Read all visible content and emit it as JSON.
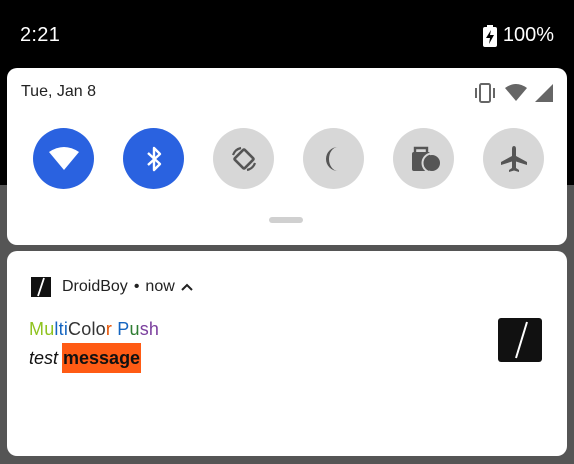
{
  "status_bar": {
    "time": "2:21",
    "battery_percent": "100%",
    "battery_icon": "battery-charging-icon"
  },
  "quick_settings": {
    "date": "Tue, Jan 8",
    "status_icons": [
      "vibrate-icon",
      "wifi-icon",
      "cell-signal-icon"
    ],
    "tiles": [
      {
        "name": "wifi",
        "icon": "wifi-icon",
        "active": true
      },
      {
        "name": "bluetooth",
        "icon": "bluetooth-icon",
        "active": true
      },
      {
        "name": "auto-rotate",
        "icon": "rotate-icon",
        "active": false
      },
      {
        "name": "do-not-disturb",
        "icon": "moon-icon",
        "active": false
      },
      {
        "name": "battery-saver",
        "icon": "battery-saver-icon",
        "active": false
      },
      {
        "name": "airplane-mode",
        "icon": "airplane-icon",
        "active": false
      }
    ],
    "colors": {
      "active": "#2a62e0",
      "inactive": "#d7d7d7"
    }
  },
  "notification": {
    "app_name": "DroidBoy",
    "separator": "•",
    "time": "now",
    "title_segments": [
      {
        "text": "M",
        "color": "#8fc31f"
      },
      {
        "text": "u",
        "color": "#8fc31f"
      },
      {
        "text": "lti",
        "color": "#1565c0"
      },
      {
        "text": "Colo",
        "color": "#333333"
      },
      {
        "text": "r",
        "color": "#e65100"
      },
      {
        "text": " ",
        "color": "#333333"
      },
      {
        "text": "P",
        "color": "#1565c0"
      },
      {
        "text": "u",
        "color": "#2e7d32"
      },
      {
        "text": "sh",
        "color": "#7b3f9e"
      }
    ],
    "body_italic": "test",
    "body_highlight": "message",
    "highlight_color": "#ff5b14"
  }
}
